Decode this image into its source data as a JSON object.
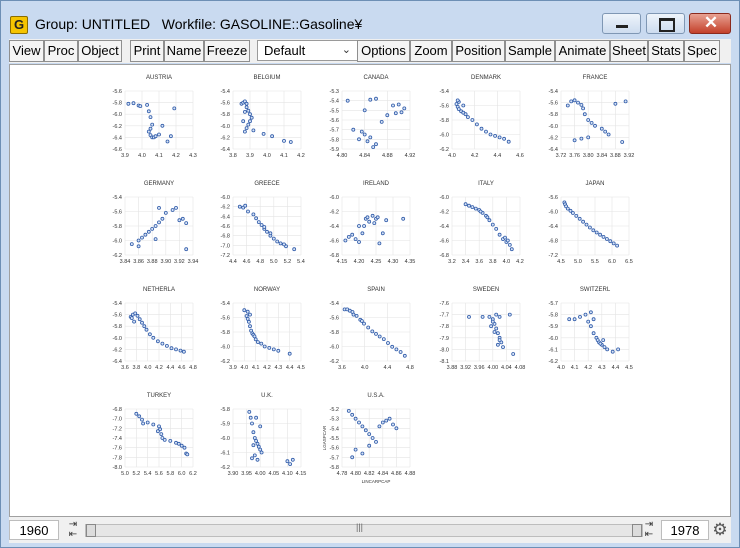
{
  "window": {
    "title": "Group: UNTITLED   Workfile: GASOLINE::Gasoline¥",
    "app_icon_letter": "G"
  },
  "toolbar": {
    "buttons": [
      "View",
      "Proc",
      "Object",
      "Print",
      "Name",
      "Freeze",
      "Options",
      "Zoom",
      "Position",
      "Sample",
      "Animate",
      "Sheet",
      "Stats",
      "Spec"
    ],
    "dropdown_value": "Default"
  },
  "slider": {
    "start_year": "1960",
    "end_year": "1978"
  },
  "chart_data": [
    {
      "type": "scatter",
      "title": "AUSTRIA",
      "xticks": [
        "3.9",
        "4.0",
        "4.1",
        "4.2",
        "4.3"
      ],
      "yticks": [
        "-5.6",
        "-5.8",
        "-6.0",
        "-6.2",
        "-6.4",
        "-6.6"
      ],
      "xlim": [
        3.9,
        4.3
      ],
      "ylim": [
        -6.6,
        -5.6
      ],
      "x": [
        3.92,
        3.95,
        3.98,
        3.99,
        4.03,
        4.04,
        4.05,
        4.06,
        4.05,
        4.04,
        4.05,
        4.06,
        4.07,
        4.08,
        4.1,
        4.12,
        4.15,
        4.17,
        4.19
      ],
      "y": [
        -5.82,
        -5.81,
        -5.85,
        -5.86,
        -5.84,
        -5.95,
        -6.05,
        -6.18,
        -6.25,
        -6.3,
        -6.36,
        -6.4,
        -6.4,
        -6.38,
        -6.35,
        -6.2,
        -6.47,
        -6.38,
        -5.9
      ]
    },
    {
      "type": "scatter",
      "title": "BELGIUM",
      "xticks": [
        "3.8",
        "3.9",
        "4.0",
        "4.1",
        "4.2"
      ],
      "yticks": [
        "-5.4",
        "-5.6",
        "-5.8",
        "-6.0",
        "-6.2",
        "-6.4"
      ],
      "xlim": [
        3.8,
        4.2
      ],
      "ylim": [
        -6.4,
        -5.4
      ],
      "x": [
        3.85,
        3.86,
        3.87,
        3.88,
        3.88,
        3.89,
        3.9,
        3.91,
        3.9,
        3.89,
        3.88,
        3.87,
        3.86,
        3.87,
        3.92,
        3.98,
        4.03,
        4.1,
        4.14
      ],
      "y": [
        -5.62,
        -5.6,
        -5.58,
        -5.62,
        -5.68,
        -5.74,
        -5.8,
        -5.86,
        -5.92,
        -5.98,
        -6.04,
        -6.1,
        -5.92,
        -5.76,
        -6.08,
        -6.14,
        -6.18,
        -6.26,
        -6.28
      ]
    },
    {
      "type": "scatter",
      "title": "CANADA",
      "xticks": [
        "4.80",
        "4.84",
        "4.88",
        "4.92"
      ],
      "yticks": [
        "-5.3",
        "-5.4",
        "-5.5",
        "-5.6",
        "-5.7",
        "-5.8",
        "-5.9"
      ],
      "xlim": [
        4.8,
        4.92
      ],
      "ylim": [
        -5.9,
        -5.3
      ],
      "x": [
        4.81,
        4.82,
        4.83,
        4.84,
        4.85,
        4.86,
        4.855,
        4.845,
        4.835,
        4.84,
        4.85,
        4.86,
        4.87,
        4.88,
        4.89,
        4.9,
        4.91,
        4.895,
        4.905
      ],
      "y": [
        -5.4,
        -5.7,
        -5.8,
        -5.75,
        -5.78,
        -5.85,
        -5.88,
        -5.82,
        -5.72,
        -5.5,
        -5.39,
        -5.38,
        -5.62,
        -5.55,
        -5.45,
        -5.44,
        -5.48,
        -5.53,
        -5.52
      ]
    },
    {
      "type": "scatter",
      "title": "DENMARK",
      "xticks": [
        "4.0",
        "4.2",
        "4.4",
        "4.6"
      ],
      "yticks": [
        "-5.4",
        "-5.6",
        "-5.8",
        "-6.0",
        "-6.2"
      ],
      "xlim": [
        4.0,
        4.6
      ],
      "ylim": [
        -6.2,
        -5.4
      ],
      "x": [
        4.04,
        4.05,
        4.06,
        4.08,
        4.1,
        4.12,
        4.14,
        4.18,
        4.22,
        4.26,
        4.3,
        4.34,
        4.38,
        4.42,
        4.46,
        4.5,
        4.06,
        4.1,
        4.05
      ],
      "y": [
        -5.58,
        -5.62,
        -5.65,
        -5.68,
        -5.7,
        -5.72,
        -5.76,
        -5.8,
        -5.86,
        -5.92,
        -5.96,
        -6.0,
        -6.02,
        -6.04,
        -6.06,
        -6.1,
        -5.55,
        -5.6,
        -5.53
      ]
    },
    {
      "type": "scatter",
      "title": "FRANCE",
      "xticks": [
        "3.72",
        "3.76",
        "3.80",
        "3.84",
        "3.88",
        "3.92"
      ],
      "yticks": [
        "-5.4",
        "-5.6",
        "-5.8",
        "-6.0",
        "-6.2",
        "-6.4"
      ],
      "xlim": [
        3.72,
        3.92
      ],
      "ylim": [
        -6.4,
        -5.4
      ],
      "x": [
        3.74,
        3.75,
        3.76,
        3.77,
        3.78,
        3.785,
        3.79,
        3.8,
        3.81,
        3.82,
        3.84,
        3.85,
        3.86,
        3.8,
        3.78,
        3.76,
        3.88,
        3.91,
        3.9
      ],
      "y": [
        -5.65,
        -5.58,
        -5.56,
        -5.6,
        -5.64,
        -5.7,
        -5.8,
        -5.9,
        -5.95,
        -6.0,
        -6.05,
        -6.1,
        -6.15,
        -6.2,
        -6.22,
        -6.25,
        -5.62,
        -5.58,
        -6.28
      ]
    },
    {
      "type": "scatter",
      "title": "GERMANY",
      "xticks": [
        "3.84",
        "3.86",
        "3.88",
        "3.90",
        "3.92",
        "3.94"
      ],
      "yticks": [
        "-5.4",
        "-5.6",
        "-5.8",
        "-6.0",
        "-6.2"
      ],
      "xlim": [
        3.84,
        3.94
      ],
      "ylim": [
        -6.2,
        -5.4
      ],
      "x": [
        3.85,
        3.86,
        3.865,
        3.87,
        3.875,
        3.88,
        3.885,
        3.89,
        3.895,
        3.9,
        3.91,
        3.915,
        3.92,
        3.925,
        3.93,
        3.89,
        3.885,
        3.86,
        3.93
      ],
      "y": [
        -6.05,
        -6.0,
        -5.96,
        -5.92,
        -5.88,
        -5.84,
        -5.8,
        -5.75,
        -5.7,
        -5.62,
        -5.58,
        -5.55,
        -5.72,
        -5.7,
        -5.76,
        -5.55,
        -5.98,
        -6.08,
        -6.12
      ]
    },
    {
      "type": "scatter",
      "title": "GREECE",
      "xticks": [
        "4.4",
        "4.6",
        "4.8",
        "5.0",
        "5.2",
        "5.4"
      ],
      "yticks": [
        "-6.0",
        "-6.2",
        "-6.4",
        "-6.6",
        "-6.8",
        "-7.0",
        "-7.2"
      ],
      "xlim": [
        4.4,
        5.4
      ],
      "ylim": [
        -7.2,
        -6.0
      ],
      "x": [
        4.5,
        4.55,
        4.58,
        4.62,
        4.7,
        4.74,
        4.78,
        4.82,
        4.86,
        4.9,
        4.95,
        5.0,
        5.05,
        5.1,
        5.18,
        5.3,
        4.86,
        4.95,
        5.15
      ],
      "y": [
        -6.2,
        -6.22,
        -6.18,
        -6.3,
        -6.36,
        -6.44,
        -6.52,
        -6.58,
        -6.66,
        -6.72,
        -6.8,
        -6.86,
        -6.92,
        -6.96,
        -7.02,
        -7.08,
        -6.62,
        -6.75,
        -6.98
      ]
    },
    {
      "type": "scatter",
      "title": "IRELAND",
      "xticks": [
        "4.15",
        "4.20",
        "4.25",
        "4.30",
        "4.35"
      ],
      "yticks": [
        "-6.0",
        "-6.2",
        "-6.4",
        "-6.6",
        "-6.8"
      ],
      "xlim": [
        4.15,
        4.35
      ],
      "ylim": [
        -6.8,
        -6.0
      ],
      "x": [
        4.16,
        4.17,
        4.18,
        4.19,
        4.2,
        4.21,
        4.215,
        4.22,
        4.225,
        4.23,
        4.24,
        4.245,
        4.25,
        4.26,
        4.27,
        4.28,
        4.33,
        4.2,
        4.255
      ],
      "y": [
        -6.6,
        -6.55,
        -6.52,
        -6.58,
        -6.62,
        -6.5,
        -6.4,
        -6.3,
        -6.28,
        -6.34,
        -6.26,
        -6.36,
        -6.3,
        -6.64,
        -6.5,
        -6.32,
        -6.3,
        -6.4,
        -6.28
      ]
    },
    {
      "type": "scatter",
      "title": "ITALY",
      "xticks": [
        "3.2",
        "3.4",
        "3.6",
        "3.8",
        "4.0",
        "4.2"
      ],
      "yticks": [
        "-6.0",
        "-6.2",
        "-6.4",
        "-6.6",
        "-6.8"
      ],
      "xlim": [
        3.2,
        4.2
      ],
      "ylim": [
        -6.8,
        -6.0
      ],
      "x": [
        3.4,
        3.45,
        3.5,
        3.55,
        3.6,
        3.65,
        3.7,
        3.75,
        3.8,
        3.85,
        3.9,
        3.95,
        4.0,
        4.05,
        4.08,
        4.02,
        3.98,
        3.62,
        3.72
      ],
      "y": [
        -6.1,
        -6.12,
        -6.14,
        -6.16,
        -6.18,
        -6.22,
        -6.26,
        -6.32,
        -6.38,
        -6.44,
        -6.52,
        -6.58,
        -6.62,
        -6.66,
        -6.72,
        -6.6,
        -6.56,
        -6.2,
        -6.28
      ]
    },
    {
      "type": "scatter",
      "title": "JAPAN",
      "xticks": [
        "4.5",
        "5.0",
        "5.5",
        "6.0",
        "6.5"
      ],
      "yticks": [
        "-5.6",
        "-6.0",
        "-6.4",
        "-6.8",
        "-7.2"
      ],
      "xlim": [
        4.5,
        6.5
      ],
      "ylim": [
        -7.2,
        -5.6
      ],
      "x": [
        4.6,
        4.62,
        4.65,
        4.7,
        4.78,
        4.85,
        4.95,
        5.05,
        5.15,
        5.25,
        5.35,
        5.45,
        5.55,
        5.65,
        5.75,
        5.85,
        5.95,
        6.05,
        6.15
      ],
      "y": [
        -5.75,
        -5.8,
        -5.86,
        -5.92,
        -5.98,
        -6.04,
        -6.12,
        -6.2,
        -6.28,
        -6.36,
        -6.44,
        -6.52,
        -6.58,
        -6.64,
        -6.7,
        -6.76,
        -6.82,
        -6.88,
        -6.94
      ]
    },
    {
      "type": "scatter",
      "title": "NETHERLA",
      "xticks": [
        "3.6",
        "3.8",
        "4.0",
        "4.2",
        "4.4",
        "4.6",
        "4.8"
      ],
      "yticks": [
        "-5.4",
        "-5.6",
        "-5.8",
        "-6.0",
        "-6.2",
        "-6.4"
      ],
      "xlim": [
        3.6,
        4.8
      ],
      "ylim": [
        -6.4,
        -5.4
      ],
      "x": [
        3.7,
        3.74,
        3.78,
        3.82,
        3.86,
        3.9,
        3.94,
        3.98,
        4.04,
        4.1,
        4.18,
        4.26,
        4.34,
        4.42,
        4.5,
        4.58,
        4.64,
        3.76,
        3.72
      ],
      "y": [
        -5.64,
        -5.6,
        -5.58,
        -5.62,
        -5.68,
        -5.74,
        -5.8,
        -5.86,
        -5.94,
        -6.0,
        -6.06,
        -6.1,
        -6.14,
        -6.18,
        -6.2,
        -6.22,
        -6.24,
        -5.72,
        -5.66
      ]
    },
    {
      "type": "scatter",
      "title": "NORWAY",
      "xticks": [
        "3.9",
        "4.0",
        "4.1",
        "4.2",
        "4.3",
        "4.4",
        "4.5"
      ],
      "yticks": [
        "-5.4",
        "-5.6",
        "-5.8",
        "-6.0",
        "-6.2"
      ],
      "xlim": [
        3.9,
        4.5
      ],
      "ylim": [
        -6.2,
        -5.4
      ],
      "x": [
        4.0,
        4.02,
        4.03,
        4.04,
        4.05,
        4.06,
        4.07,
        4.08,
        4.09,
        4.1,
        4.12,
        4.15,
        4.18,
        4.22,
        4.26,
        4.3,
        4.4,
        4.05,
        4.03
      ],
      "y": [
        -5.5,
        -5.58,
        -5.62,
        -5.66,
        -5.72,
        -5.78,
        -5.82,
        -5.84,
        -5.86,
        -5.9,
        -5.94,
        -5.96,
        -6.0,
        -6.02,
        -6.04,
        -6.06,
        -6.1,
        -5.56,
        -5.52
      ]
    },
    {
      "type": "scatter",
      "title": "SPAIN",
      "xticks": [
        "3.6",
        "4.0",
        "4.4",
        "4.8"
      ],
      "yticks": [
        "-5.4",
        "-5.6",
        "-5.8",
        "-6.0",
        "-6.2"
      ],
      "xlim": [
        3.5,
        4.8
      ],
      "ylim": [
        -6.2,
        -5.3
      ],
      "x": [
        3.55,
        3.6,
        3.65,
        3.7,
        3.78,
        3.85,
        3.92,
        4.0,
        4.08,
        4.15,
        4.22,
        4.3,
        4.38,
        4.46,
        4.54,
        4.62,
        4.7,
        3.72,
        3.88
      ],
      "y": [
        -5.4,
        -5.4,
        -5.42,
        -5.44,
        -5.5,
        -5.56,
        -5.62,
        -5.68,
        -5.74,
        -5.78,
        -5.82,
        -5.86,
        -5.92,
        -5.98,
        -6.02,
        -6.06,
        -6.12,
        -5.48,
        -5.58
      ]
    },
    {
      "type": "scatter",
      "title": "SWEDEN",
      "xticks": [
        "3.88",
        "3.92",
        "3.96",
        "4.00",
        "4.04",
        "4.08"
      ],
      "yticks": [
        "-7.6",
        "-7.7",
        "-7.8",
        "-7.9",
        "-8.0",
        "-8.1"
      ],
      "xlim": [
        3.88,
        4.08
      ],
      "ylim": [
        -8.1,
        -7.6
      ],
      "x": [
        3.99,
        4.0,
        4.005,
        4.01,
        4.015,
        4.02,
        4.025,
        4.03,
        4.0,
        3.995,
        4.01,
        4.02,
        4.005,
        3.93,
        3.97,
        4.06,
        4.05,
        4.015,
        4.02
      ],
      "y": [
        -7.72,
        -7.74,
        -7.78,
        -7.82,
        -7.86,
        -7.9,
        -7.94,
        -7.98,
        -7.76,
        -7.8,
        -7.7,
        -7.72,
        -7.85,
        -7.72,
        -7.72,
        -8.04,
        -7.7,
        -7.96,
        -7.92
      ]
    },
    {
      "type": "scatter",
      "title": "SWITZERL",
      "xticks": [
        "4.0",
        "4.1",
        "4.2",
        "4.3",
        "4.4",
        "4.5"
      ],
      "yticks": [
        "-5.7",
        "-5.8",
        "-5.9",
        "-6.0",
        "-6.1",
        "-6.2"
      ],
      "xlim": [
        4.0,
        4.5
      ],
      "ylim": [
        -6.2,
        -5.7
      ],
      "x": [
        4.06,
        4.1,
        4.14,
        4.18,
        4.2,
        4.22,
        4.24,
        4.26,
        4.27,
        4.28,
        4.3,
        4.32,
        4.34,
        4.22,
        4.24,
        4.38,
        4.42,
        4.29,
        4.31
      ],
      "y": [
        -5.84,
        -5.84,
        -5.82,
        -5.8,
        -5.86,
        -5.9,
        -5.96,
        -6.0,
        -6.02,
        -6.04,
        -6.06,
        -6.08,
        -6.1,
        -5.78,
        -5.84,
        -6.12,
        -6.1,
        -6.05,
        -6.02
      ]
    },
    {
      "type": "scatter",
      "title": "TURKEY",
      "xticks": [
        "5.0",
        "5.2",
        "5.4",
        "5.6",
        "5.8",
        "6.0",
        "6.2"
      ],
      "yticks": [
        "-6.8",
        "-7.0",
        "-7.2",
        "-7.4",
        "-7.6",
        "-7.8",
        "-8.0"
      ],
      "xlim": [
        5.0,
        6.2
      ],
      "ylim": [
        -8.0,
        -6.8
      ],
      "x": [
        5.2,
        5.25,
        5.3,
        5.4,
        5.5,
        5.6,
        5.62,
        5.64,
        5.66,
        5.7,
        5.8,
        5.9,
        5.95,
        6.0,
        6.05,
        6.08,
        6.1,
        5.32,
        5.58
      ],
      "y": [
        -6.9,
        -6.95,
        -7.02,
        -7.08,
        -7.12,
        -7.16,
        -7.22,
        -7.32,
        -7.4,
        -7.44,
        -7.46,
        -7.5,
        -7.52,
        -7.56,
        -7.6,
        -7.72,
        -7.74,
        -7.1,
        -7.26
      ]
    },
    {
      "type": "scatter",
      "title": "U.K.",
      "xticks": [
        "3.90",
        "3.95",
        "4.00",
        "4.05",
        "4.10",
        "4.15"
      ],
      "yticks": [
        "-5.8",
        "-5.9",
        "-6.0",
        "-6.1",
        "-6.2"
      ],
      "xlim": [
        3.9,
        4.15
      ],
      "ylim": [
        -6.2,
        -5.8
      ],
      "x": [
        3.96,
        3.965,
        3.97,
        3.975,
        3.98,
        3.985,
        3.99,
        3.995,
        4.0,
        4.005,
        3.98,
        3.97,
        3.99,
        4.1,
        4.11,
        4.12,
        3.985,
        4.0,
        3.975
      ],
      "y": [
        -5.82,
        -5.86,
        -5.9,
        -5.96,
        -6.0,
        -6.02,
        -6.04,
        -6.06,
        -6.08,
        -6.1,
        -6.12,
        -6.14,
        -6.15,
        -6.16,
        -6.18,
        -6.15,
        -5.86,
        -5.92,
        -6.05
      ]
    },
    {
      "type": "scatter",
      "title": "U.S.A.",
      "xlabel": "LINCARPCAP",
      "ylabel": "LGASPCAR",
      "xticks": [
        "4.78",
        "4.80",
        "4.82",
        "4.84",
        "4.86",
        "4.88"
      ],
      "yticks": [
        "-5.2",
        "-5.3",
        "-5.4",
        "-5.5",
        "-5.6",
        "-5.7",
        "-5.8"
      ],
      "xlim": [
        4.78,
        4.88
      ],
      "ylim": [
        -5.8,
        -5.2
      ],
      "x": [
        4.79,
        4.795,
        4.8,
        4.805,
        4.81,
        4.815,
        4.82,
        4.825,
        4.83,
        4.835,
        4.84,
        4.845,
        4.85,
        4.855,
        4.86,
        4.8,
        4.81,
        4.82,
        4.795
      ],
      "y": [
        -5.22,
        -5.26,
        -5.3,
        -5.34,
        -5.38,
        -5.42,
        -5.46,
        -5.5,
        -5.54,
        -5.38,
        -5.34,
        -5.32,
        -5.3,
        -5.36,
        -5.4,
        -5.62,
        -5.66,
        -5.58,
        -5.7
      ]
    }
  ]
}
